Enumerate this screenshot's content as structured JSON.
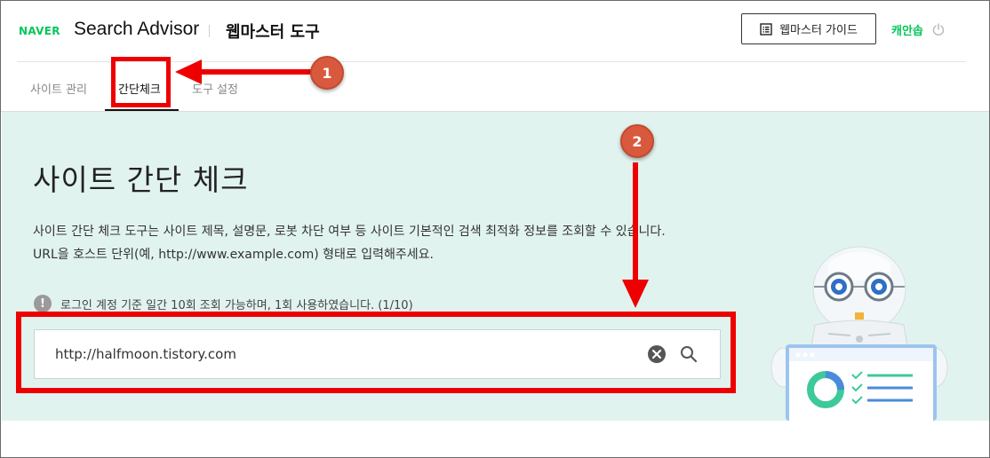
{
  "header": {
    "brand": "NAVER",
    "product": "Search Advisor",
    "tool": "웹마스터 도구",
    "guide_button": "웹마스터 가이드",
    "user": "캐안솝",
    "guide_icon": "document-list-icon",
    "logout_icon": "power-icon"
  },
  "tabs": [
    {
      "label": "사이트 관리"
    },
    {
      "label": "간단체크"
    },
    {
      "label": "도구 설정"
    }
  ],
  "main": {
    "title": "사이트 간단 체크",
    "desc_line1": "사이트 간단 체크 도구는 사이트 제목, 설명문, 로봇 차단 여부 등 사이트 기본적인 검색 최적화 정보를 조회할 수 있습니다.",
    "desc_line2": "URL을 호스트 단위(예, http://www.example.com) 형태로 입력해주세요.",
    "notice_icon": "!",
    "notice": "로그인 계정 기준 일간 10회 조회 가능하며, 1회 사용하였습니다. (1/10)",
    "search_value": "http://halfmoon.tistory.com"
  },
  "annotations": {
    "badge1": "1",
    "badge2": "2",
    "color": "#ee0000",
    "badge_color": "#d9593e"
  },
  "colors": {
    "brand_green": "#03c75a",
    "hero_bg": "#e1f3ef"
  }
}
